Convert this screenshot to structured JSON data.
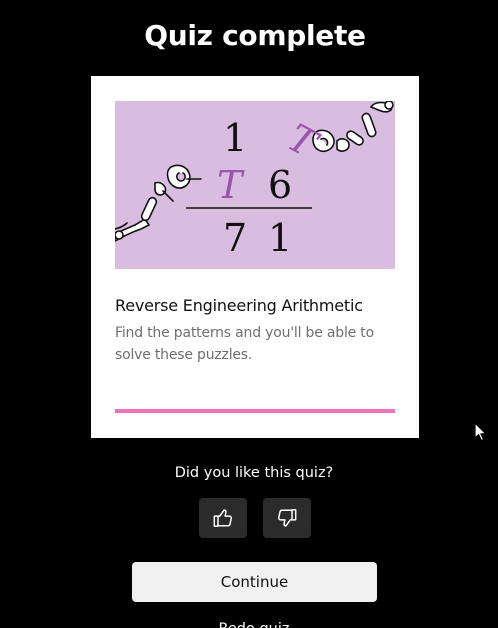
{
  "page": {
    "title": "Quiz complete"
  },
  "card": {
    "illustration": {
      "top_digit": "1",
      "middle_variable": "T",
      "middle_digit": "6",
      "result_left": "7",
      "result_right": "1",
      "flying_variable": "T",
      "colors": {
        "background": "#d9bde0",
        "variable": "#9a55ad"
      }
    },
    "title": "Reverse Engineering Arithmetic",
    "description": "Find the patterns and you'll be able to solve these puzzles.",
    "progress_fraction": 1.0,
    "progress_color": "#ee72b4"
  },
  "feedback": {
    "question": "Did you like this quiz?",
    "like_icon": "thumbs-up-icon",
    "dislike_icon": "thumbs-down-icon"
  },
  "actions": {
    "continue_label": "Continue",
    "redo_label": "Redo quiz"
  }
}
